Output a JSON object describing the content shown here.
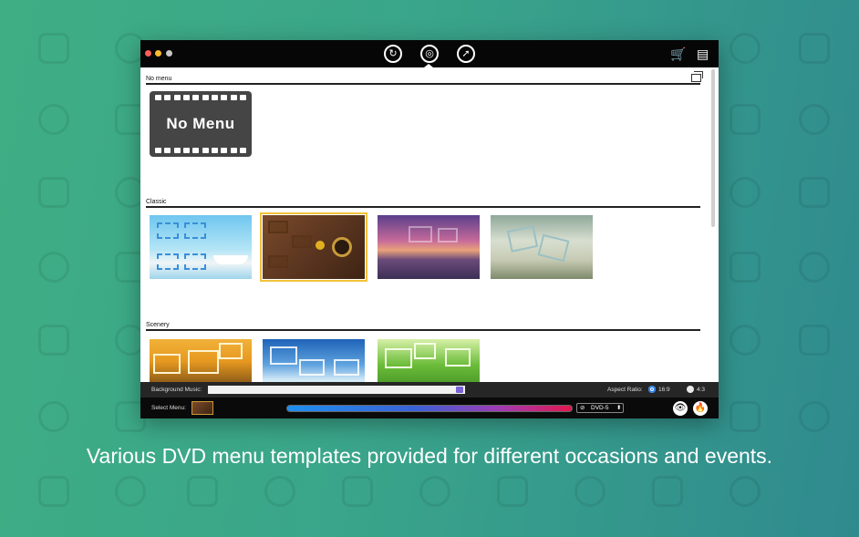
{
  "toolbar": {
    "buttons": [
      {
        "name": "convert-button",
        "icon": "refresh-icon",
        "glyph": "↻"
      },
      {
        "name": "burn-disc-button",
        "icon": "disc-icon",
        "glyph": "◎"
      },
      {
        "name": "share-button",
        "icon": "share-icon",
        "glyph": "➚"
      }
    ],
    "cart_glyph": "🛒",
    "store_glyph": "▤"
  },
  "sections": [
    {
      "id": "no-menu",
      "label": "No menu"
    },
    {
      "id": "classic",
      "label": "Classic"
    },
    {
      "id": "scenery",
      "label": "Scenery"
    }
  ],
  "no_menu_tile": {
    "text": "No Menu"
  },
  "classic_templates": [
    {
      "name": "beach-frames",
      "selected": false
    },
    {
      "name": "wood-table",
      "selected": true
    },
    {
      "name": "sunset-sea",
      "selected": false
    },
    {
      "name": "film-reel-clouds",
      "selected": false
    }
  ],
  "scenery_templates": [
    {
      "name": "autumn-sunset"
    },
    {
      "name": "blue-sky-beach"
    },
    {
      "name": "green-leaves"
    }
  ],
  "settings": {
    "background_music_label": "Background Music:",
    "background_music_value": "",
    "aspect_ratio_label": "Aspect Ratio:",
    "aspect_options": [
      {
        "label": "16:9",
        "selected": true
      },
      {
        "label": "4:3",
        "selected": false
      }
    ],
    "select_menu_label": "Select Menu:",
    "disc_type": "DVD-5",
    "disc_type_arrows": "⬍"
  },
  "action_buttons": [
    {
      "name": "preview-button",
      "icon": "eye-icon",
      "glyph": "👁"
    },
    {
      "name": "burn-button",
      "icon": "flame-icon",
      "glyph": "🔥"
    }
  ],
  "caption": "Various DVD menu templates provided for different occasions and events.",
  "colors": {
    "background_start": "#3fae84",
    "background_end": "#2f8a8e",
    "selected_outline": "#f3c23a",
    "radio_on": "#2c7be5"
  }
}
